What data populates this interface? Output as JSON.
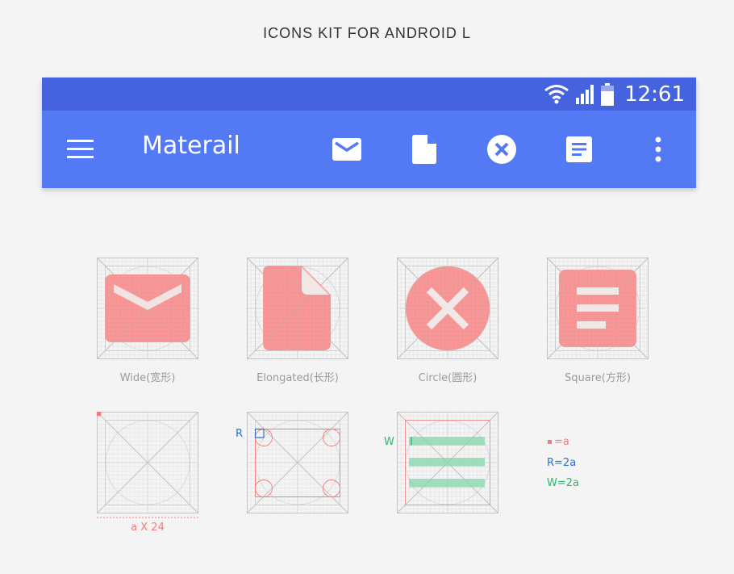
{
  "page": {
    "title": "ICONS KIT FOR ANDROID L"
  },
  "statusbar": {
    "time": "12:61"
  },
  "appbar": {
    "title": "Materail",
    "actions": [
      "mail-icon",
      "document-icon",
      "close-circle-icon",
      "note-icon",
      "more-vert-icon"
    ]
  },
  "colors": {
    "statusbar": "#4563de",
    "appbar": "#5479f5",
    "shape": "#f78a8a",
    "grid": "#cfcfcf",
    "radius_blue": "#2f6fd0",
    "width_green": "#2db56e"
  },
  "shapes": [
    {
      "label": "Wide(宽形)"
    },
    {
      "label": "Elongated(长形)"
    },
    {
      "label": "Circle(圆形)"
    },
    {
      "label": "Square(方形)"
    }
  ],
  "keylines": {
    "unit_caption": "a X 24",
    "r_marker": "R",
    "w_marker": "W"
  },
  "legend": {
    "a": "=a",
    "r": "R=2a",
    "w": "W=2a"
  }
}
